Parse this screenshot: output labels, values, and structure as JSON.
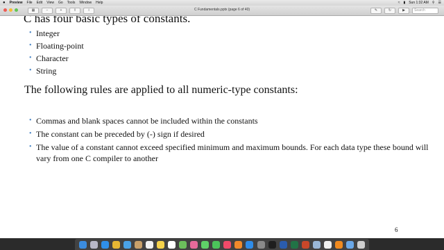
{
  "menubar": {
    "apple": "",
    "app_name": "Preview",
    "items": [
      "File",
      "Edit",
      "View",
      "Go",
      "Tools",
      "Window",
      "Help"
    ],
    "clock": "Sun 1:32 AM"
  },
  "window": {
    "title": "C Fundamentals.pptx (page 6 of 40)",
    "zoom": "100%",
    "search_placeholder": "Search"
  },
  "slide": {
    "heading1": "C has four basic types of constants.",
    "types": [
      "Integer",
      "Floating-point",
      "Character",
      "String"
    ],
    "heading2": "The following rules are applied to all numeric-type constants:",
    "rules": [
      "Commas and blank spaces cannot be included within the constants",
      "The constant can be preceded by (-) sign if desired",
      "The value of a constant cannot exceed specified minimum and maximum bounds. For each data type these bound will vary from one C compiler to another"
    ],
    "page_number": "6"
  },
  "dock": {
    "apps": [
      "finder-icon",
      "launchpad-icon",
      "safari-icon",
      "chrome-icon",
      "mail-icon",
      "contacts-icon",
      "calendar-icon",
      "notes-icon",
      "reminders-icon",
      "maps-icon",
      "photos-icon",
      "messages-icon",
      "facetime-icon",
      "music-icon",
      "books-icon",
      "appstore-icon",
      "settings-icon",
      "terminal-icon",
      "word-icon",
      "excel-icon",
      "powerpoint-icon",
      "preview-icon",
      "textedit-icon",
      "vlc-icon",
      "folder-icon",
      "trash-icon"
    ],
    "colors": [
      "#3b8de0",
      "#b8b8c8",
      "#2f8fe8",
      "#e6b733",
      "#4aa3e8",
      "#c8a06a",
      "#f2f2f2",
      "#f5d24b",
      "#ffffff",
      "#6cbf5c",
      "#e86a9a",
      "#5fd068",
      "#4bc35a",
      "#f04a6a",
      "#f08a2a",
      "#2e8ce8",
      "#8a8a8a",
      "#1e1e1e",
      "#2b5cad",
      "#217346",
      "#c9472a",
      "#9ab8d8",
      "#f0f0f0",
      "#f08a1e",
      "#6aa8e8",
      "#cfcfcf"
    ]
  }
}
